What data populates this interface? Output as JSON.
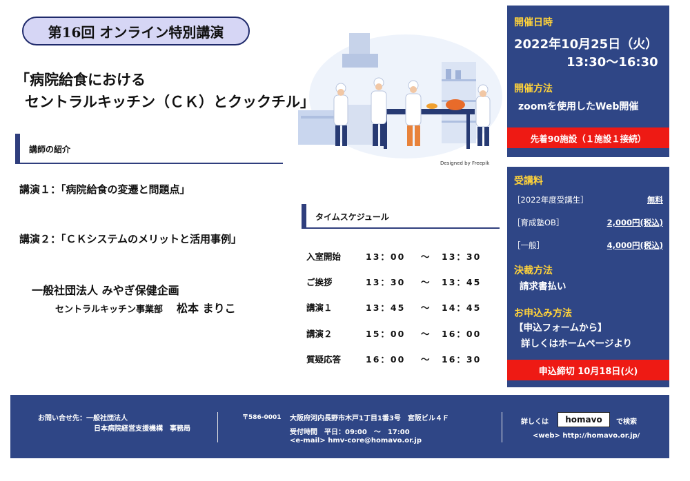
{
  "badge": "第16回 オンライン特別講演",
  "title": {
    "line1": "「病院給食における",
    "line2": "セントラルキッチン（ＣＫ）とクックチル」"
  },
  "speaker_section": {
    "heading": "講師の紹介",
    "lecture1": "講演１：「病院給食の変遷と問題点」",
    "lecture2": "講演２：「ＣＫシステムのメリットと活用事例」",
    "org": "一般社団法人 みやぎ保健企画",
    "dept": "セントラルキッチン事業部",
    "name": "松本 まりこ"
  },
  "illustration_credit": "Designed by Freepik",
  "schedule": {
    "heading": "タイムスケジュール",
    "rows": [
      {
        "label": "入室開始",
        "start": "13：00",
        "tilde": "〜",
        "end": "13：30"
      },
      {
        "label": "ご挨拶",
        "start": "13：30",
        "tilde": "〜",
        "end": "13：45"
      },
      {
        "label": "講演１",
        "start": "13：45",
        "tilde": "〜",
        "end": "14：45"
      },
      {
        "label": "講演２",
        "start": "15：00",
        "tilde": "〜",
        "end": "16：00"
      },
      {
        "label": "質疑応答",
        "start": "16：00",
        "tilde": "〜",
        "end": "16：30"
      }
    ]
  },
  "event_panel": {
    "date_heading": "開催日時",
    "date": "2022年10月25日（火）",
    "time": "13:30〜16:30",
    "method_heading": "開催方法",
    "method": "zoomを使用したWeb開催",
    "capacity": "先着90施設（１施設１接続）"
  },
  "fee_panel": {
    "fee_heading": "受講料",
    "fees": [
      {
        "label": "［2022年度受講生］",
        "value": "無料"
      },
      {
        "label": "［育成塾OB］",
        "value": "2,000円(税込)"
      },
      {
        "label": "［一般］",
        "value": "4,000円(税込)"
      }
    ],
    "payment_heading": "決裁方法",
    "payment": "請求書払い",
    "apply_heading": "お申込み方法",
    "apply_line1": "【申込フォームから】",
    "apply_line2": "詳しくはホームページより",
    "deadline": "申込締切 10月18日(火)"
  },
  "footer": {
    "contact_label": "お問い合せ先：一般社団法人",
    "contact_org": "日本病院経営支援機構　事務局",
    "postal": "〒586-0001",
    "address": "大阪府河内長野市木戸1丁目1番3号　宮阪ビル４Ｆ",
    "hours": "受付時間　平日：09:00　〜　17:00",
    "email": "<e-mail> hmv-core@homavo.or.jp",
    "search_prefix": "詳しくは",
    "search_keyword": "homavo",
    "search_suffix": "で検索",
    "web": "<web> http://homavo.or.jp/"
  },
  "colors": {
    "navy": "#2f4686",
    "accent_yellow": "#ffd23a",
    "alert_red": "#ee1a14",
    "badge_fill": "#d6d6f5"
  }
}
